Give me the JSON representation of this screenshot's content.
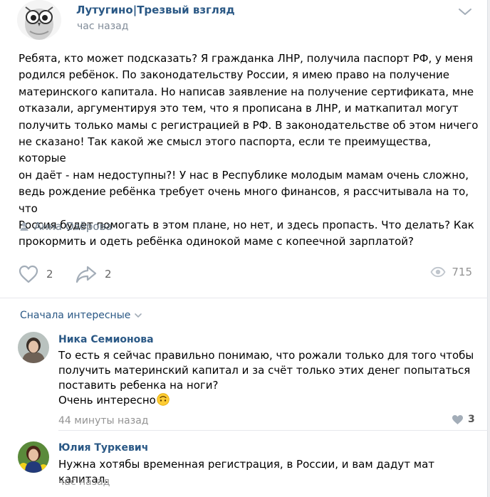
{
  "post": {
    "group_name": "Лутугино|Трезвый взгляд",
    "time": "час назад",
    "text_lines": [
      "Ребята, кто может подсказать? Я гражданка ЛНР, получила паспорт РФ, у меня",
      "родился ребёнок. По законодательству России, я имею право на получение",
      "материнского капитала. Но написав заявление на получение сертификата, мне",
      "отказали, аргументируя это тем, что я прописана в ЛНР, и маткапитал могут",
      "получить только мамы с регистрацией в РФ. В законодательстве об этом ничего",
      "не сказано! Так какой же смысл этого паспорта, если те преимущества, которые",
      "он даёт - нам недоступны?! У нас в Республике молодым мамам очень сложно,",
      "ведь рождение ребёнка требует очень много финансов, я рассчитывала на то, что",
      "Россия будет помогать в этом плане, но нет, и здесь пропасть. Что делать? Как",
      "прокормить и одеть ребёнка одинокой маме с копеечной зарплатой?"
    ],
    "author": "Анна Озёрова",
    "likes": "2",
    "shares": "2",
    "views": "715"
  },
  "comments_sort": "Сначала интересные",
  "comments": [
    {
      "name": "Ника Семионова",
      "lines": [
        "То есть я сейчас правильно понимаю, что рожали только для того чтобы",
        "получить материнский капитал и за счёт только этих денег попытаться",
        "поставить ребенка на ноги?",
        "Очень интересно"
      ],
      "time": "44 минуты назад",
      "likes": "3"
    },
    {
      "name": "Юлия Туркевич",
      "lines": [
        "Нужна хотябы временная регистрация, в России, и вам дадут мат капитал."
      ],
      "time": "час назад"
    }
  ],
  "colors": {
    "link": "#2a5885",
    "secondary": "#818c99",
    "icon": "#a3adb8"
  }
}
